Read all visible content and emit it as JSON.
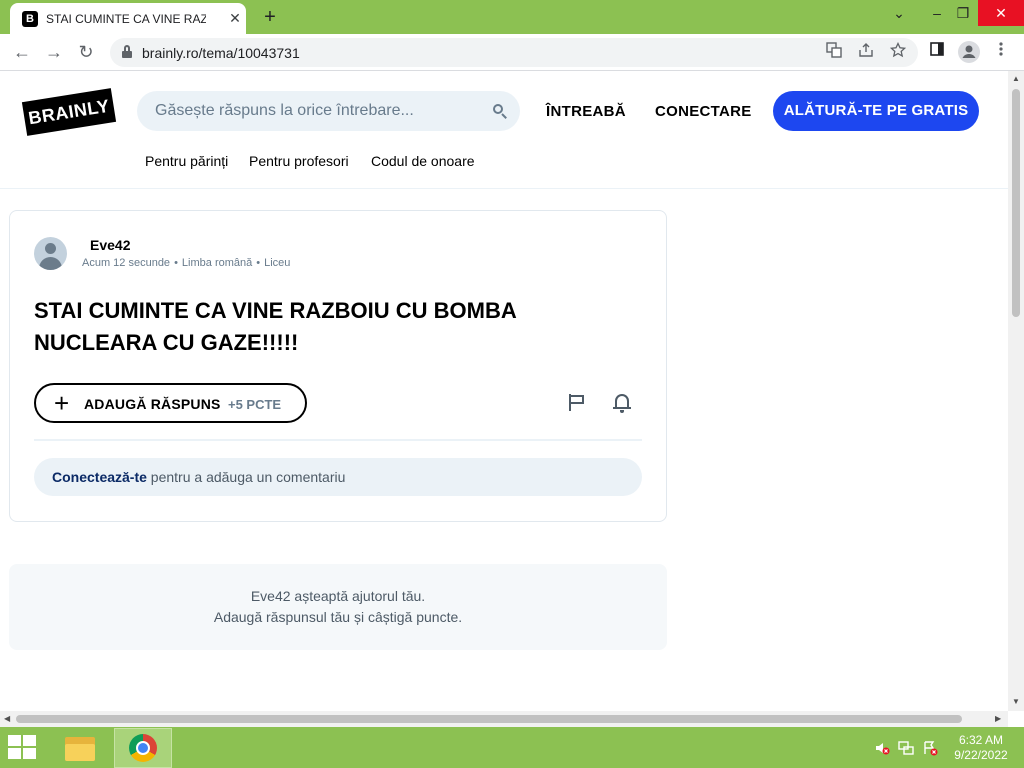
{
  "browser": {
    "tab_title": "STAI CUMINTE CA VINE RAZBOIU CU BOMBA NUCLEARA CU GAZE!!!!!",
    "tab_favicon": "B",
    "tab_close": "✕",
    "new_tab": "+",
    "url": "brainly.ro/tema/10043731",
    "window_controls": {
      "minimize": "⌄",
      "maximize": "–",
      "restore": "❐",
      "close": "✕"
    },
    "nav_back": "←",
    "nav_forward": "→",
    "nav_reload": "↻",
    "icons": [
      "lock-icon",
      "translate-icon",
      "share-icon",
      "star-icon",
      "side-panel-icon",
      "profile-icon",
      "menu-icon"
    ]
  },
  "site": {
    "logo": "BRAINLY",
    "search_placeholder": "Găsește răspuns la orice întrebare...",
    "nav_ask": "ÎNTREABĂ",
    "nav_login": "CONECTARE",
    "join_button": "ALĂTURĂ-TE PE GRATIS",
    "sub_links": [
      "Pentru părinți",
      "Pentru profesori",
      "Codul de onoare"
    ],
    "colors": {
      "accent_blue": "#1d47f0",
      "search_bg": "#ebf2f7"
    }
  },
  "question": {
    "author": "Eve42",
    "time": "Acum 12 secunde",
    "language": "Limba română",
    "level": "Liceu",
    "meta_separator": "•",
    "title": "STAI CUMINTE CA VINE RAZBOIU CU BOMBA NUCLEARA CU GAZE!!!!!",
    "add_answer_label": "ADAUGĂ RĂSPUNS",
    "add_answer_points": "+5 PCTE",
    "add_answer_plus": "+",
    "comment_link": "Conectează-te",
    "comment_rest": " pentru a adăuga un comentariu"
  },
  "waiting": {
    "line1": "Eve42 așteaptă ajutorul tău.",
    "line2": "Adaugă răspunsul tău și câștigă puncte."
  },
  "taskbar": {
    "time": "6:32 AM",
    "date": "9/22/2022",
    "tray_icons": [
      "volume-muted-icon",
      "network-icon",
      "action-center-icon"
    ]
  }
}
